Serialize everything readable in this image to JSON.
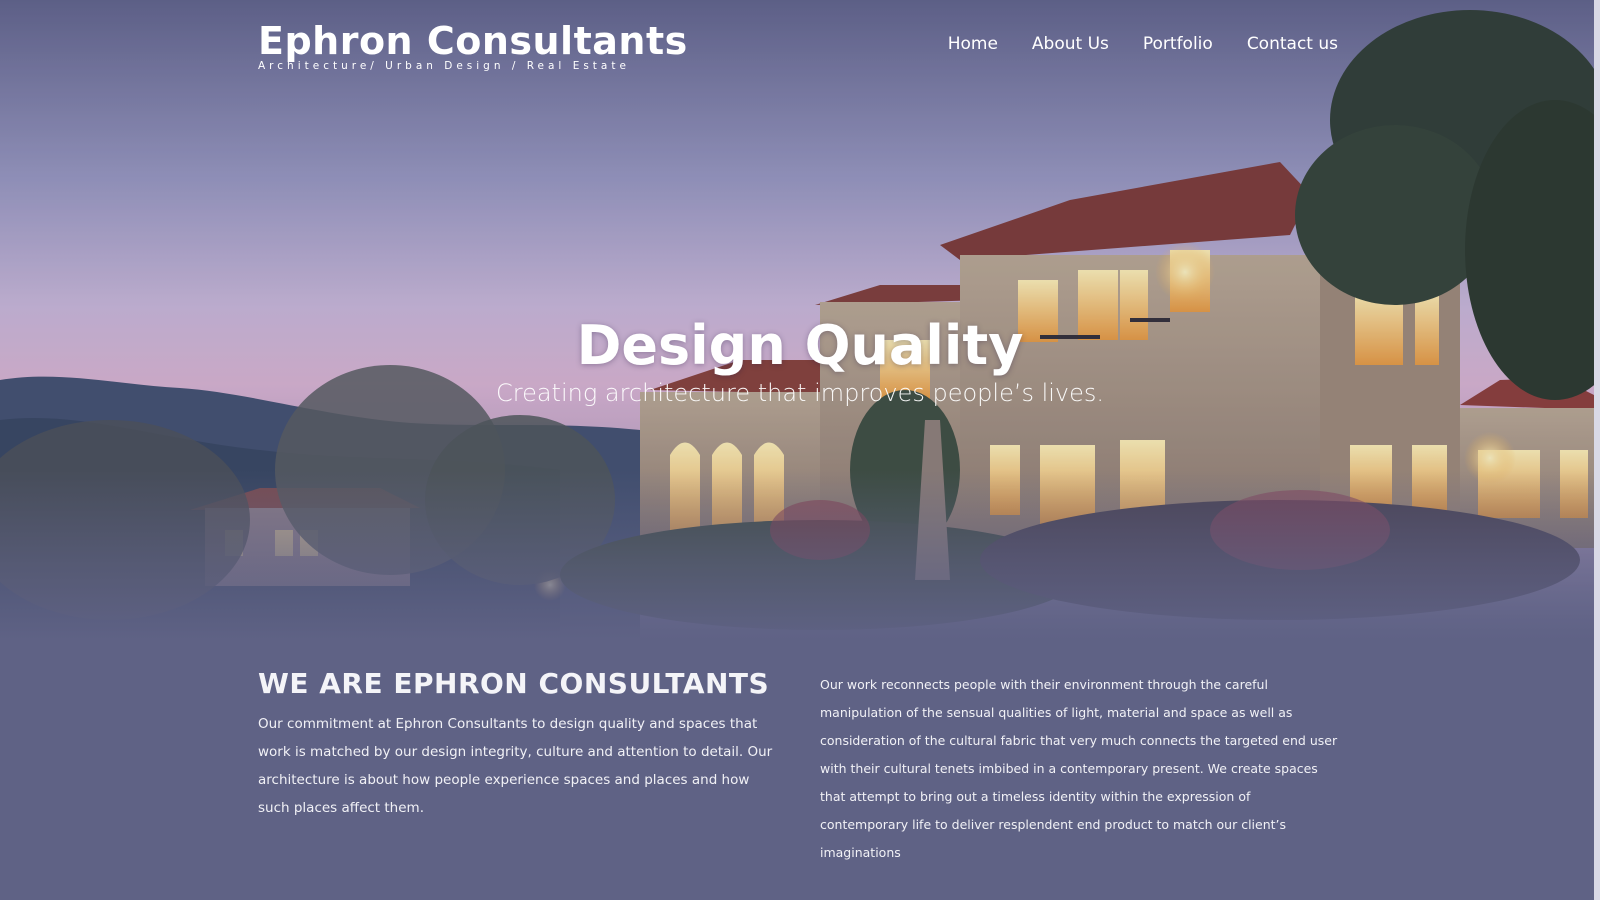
{
  "brand": {
    "name": "Ephron Consultants",
    "tagline": "Architecture/ Urban Design / Real Estate"
  },
  "nav": {
    "items": [
      {
        "label": "Home"
      },
      {
        "label": "About Us"
      },
      {
        "label": "Portfolio"
      },
      {
        "label": "Contact us"
      }
    ]
  },
  "hero": {
    "title": "Design Quality",
    "subtitle": "Creating architecture that improves people’s lives."
  },
  "about": {
    "heading": "WE ARE EPHRON CONSULTANTS",
    "left_text": "Our commitment at Ephron Consultants to design quality and spaces that work is matched by our design integrity, culture and attention to detail. Our architecture is about how people experience spaces and places and how such places affect them.",
    "right_text": "Our work reconnects people with their environment through the careful manipulation of the sensual qualities of light, material and space as well as consideration of the cultural fabric that very much connects the targeted end user with their cultural tenets imbibed in a contemporary present. We create spaces that attempt to bring out a timeless identity within the expression of contemporary life to deliver resplendent end product to match our client’s imaginations"
  },
  "colors": {
    "page_background": "#5f6285",
    "text": "#ffffff"
  }
}
